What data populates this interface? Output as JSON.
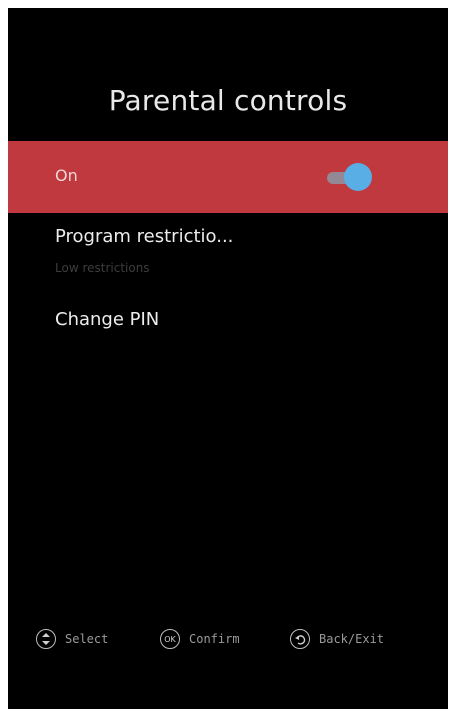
{
  "title": "Parental controls",
  "toggle_row": {
    "label": "On",
    "state": "on",
    "highlight_color": "#c0393e",
    "knob_color": "#5aaee6"
  },
  "items": [
    {
      "label": "Program restrictio...",
      "sub": "Low restrictions"
    },
    {
      "label": "Change PIN"
    }
  ],
  "footer": [
    {
      "icon": "navigate-up-down-icon",
      "label": "Select"
    },
    {
      "icon": "ok-button-icon",
      "icon_text": "OK",
      "label": "Confirm"
    },
    {
      "icon": "back-arrow-icon",
      "label": "Back/Exit"
    }
  ]
}
